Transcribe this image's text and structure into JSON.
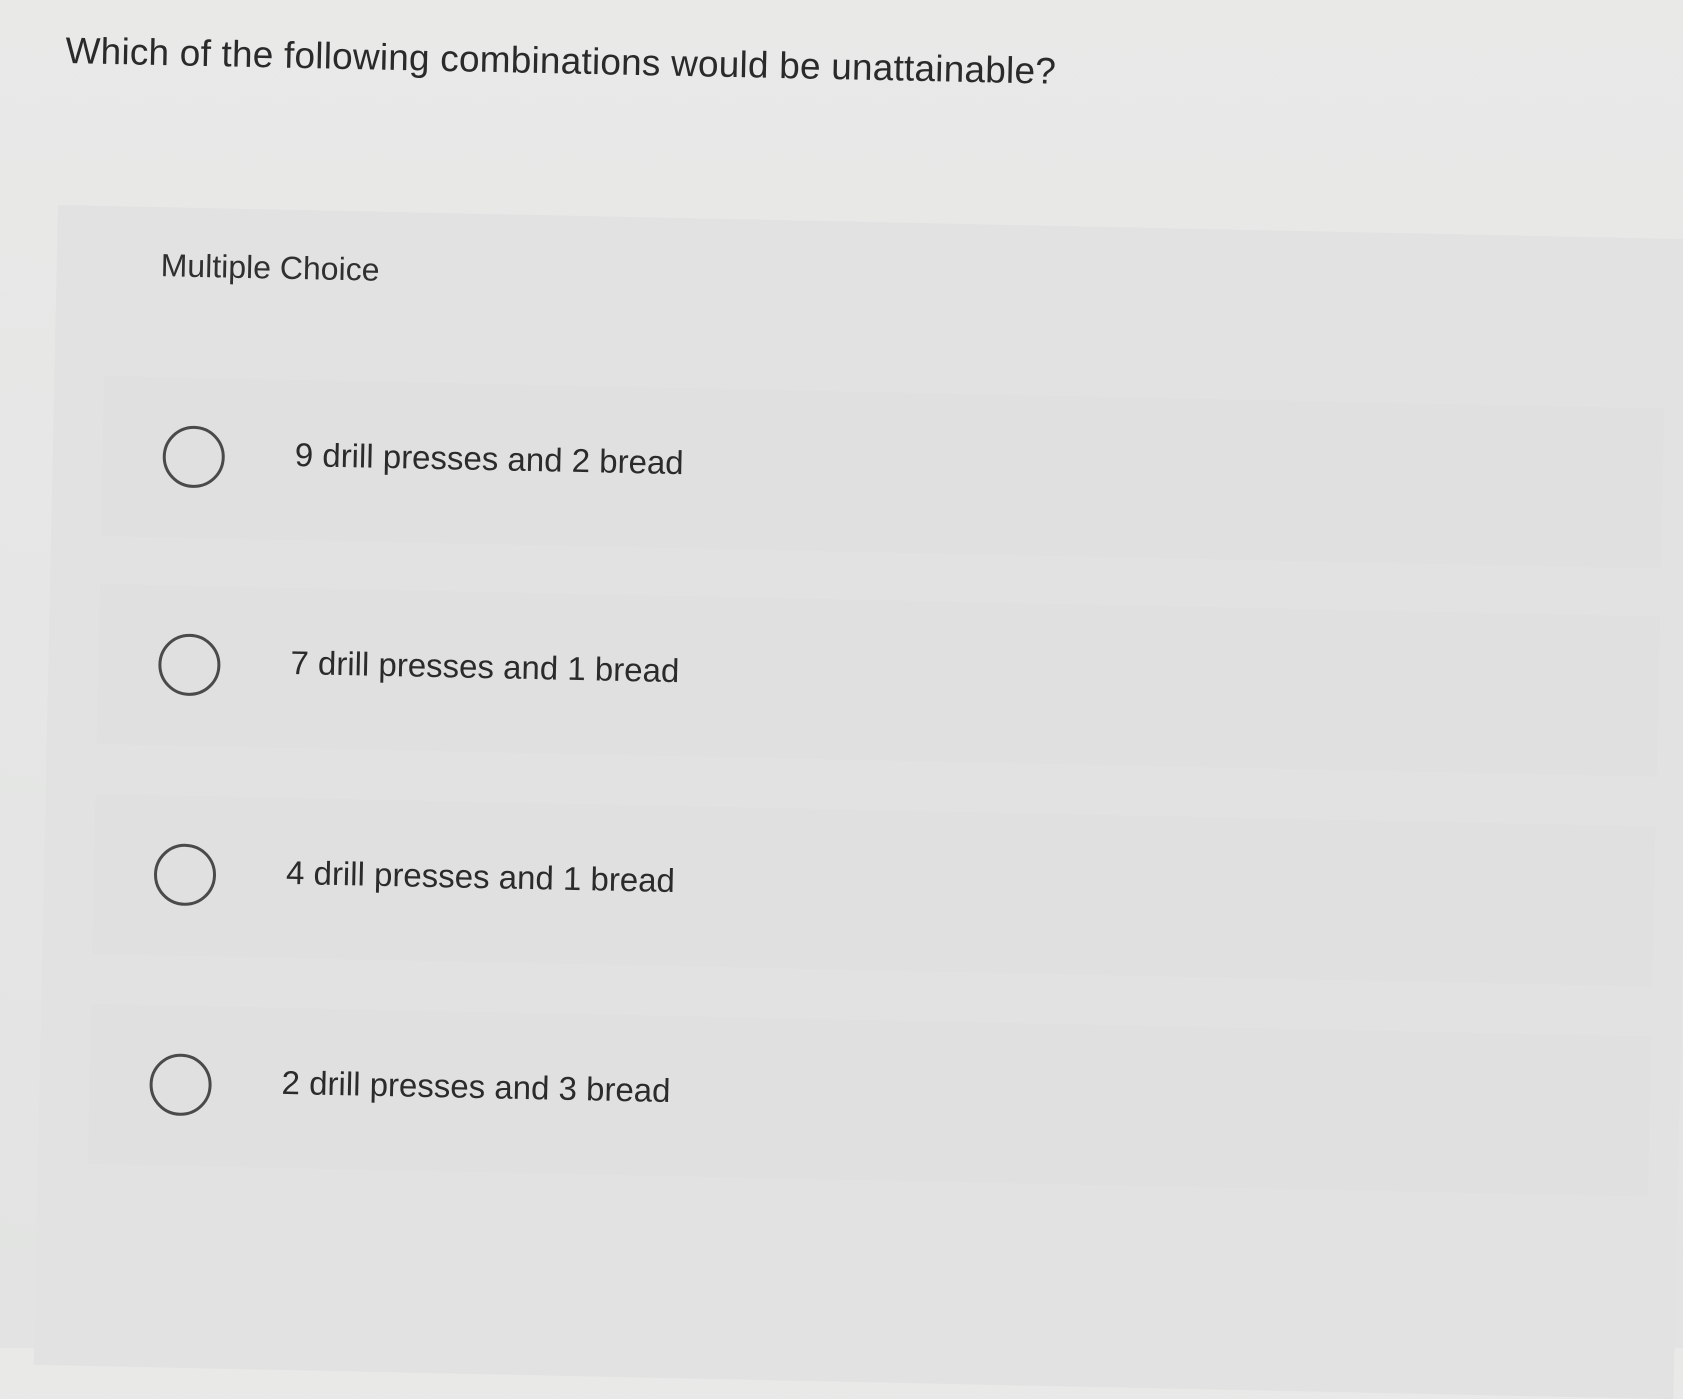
{
  "question": {
    "text": "Which of the following combinations would be unattainable?"
  },
  "section": {
    "label": "Multiple Choice"
  },
  "options": [
    {
      "label": "9 drill presses and 2 bread",
      "selected": false
    },
    {
      "label": "7 drill presses and 1 bread",
      "selected": false
    },
    {
      "label": "4 drill presses and 1 bread",
      "selected": false
    },
    {
      "label": "2 drill presses and 3 bread",
      "selected": false
    }
  ]
}
